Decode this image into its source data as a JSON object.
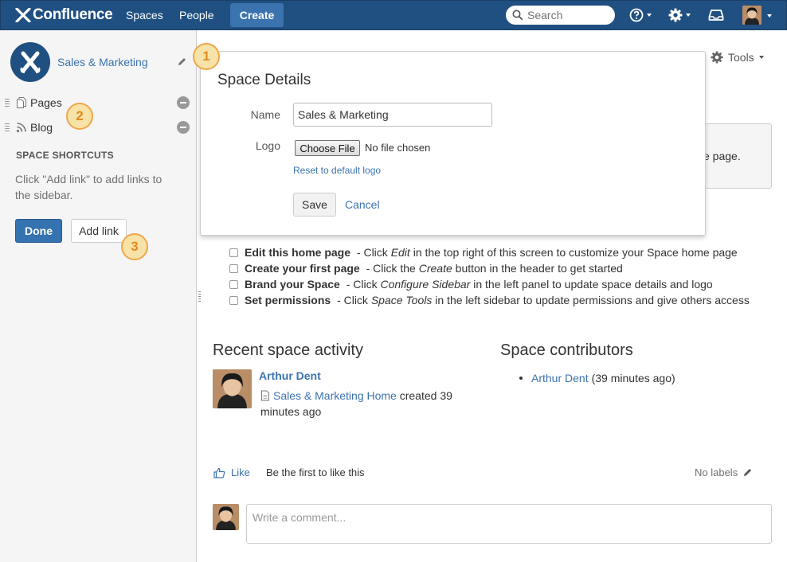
{
  "header": {
    "logo_text": "Confluence",
    "nav": {
      "spaces": "Spaces",
      "people": "People"
    },
    "create_label": "Create",
    "search_placeholder": "Search",
    "icons": [
      "help-icon",
      "gear-icon",
      "notifications-icon",
      "user-avatar"
    ],
    "brand_color": "#205081"
  },
  "sidebar": {
    "space_name": "Sales & Marketing",
    "items": [
      {
        "label": "Pages",
        "icon": "pages-icon"
      },
      {
        "label": "Blog",
        "icon": "blog-rss-icon"
      }
    ],
    "shortcuts_title": "SPACE SHORTCUTS",
    "shortcuts_help": "Click \"Add link\" to add links to the sidebar.",
    "done_label": "Done",
    "add_link_label": "Add link"
  },
  "callouts": [
    "1",
    "2",
    "3"
  ],
  "dialog": {
    "title": "Space Details",
    "name_label": "Name",
    "name_value": "Sales & Marketing",
    "logo_label": "Logo",
    "choose_file": "Choose File",
    "no_file": "No file chosen",
    "reset_logo": "Reset to default logo",
    "save_label": "Save",
    "cancel_label": "Cancel"
  },
  "main": {
    "tools_label": "Tools",
    "info_partial": "e page.",
    "tasks": [
      {
        "bold": "Edit this home page",
        "parts": [
          " - Click ",
          "Edit",
          " in the top right of this screen to customize your Space home page"
        ]
      },
      {
        "bold": "Create your first page",
        "parts": [
          " - Click the ",
          "Create",
          " button in the header to get started"
        ]
      },
      {
        "bold": "Brand your Space",
        "parts": [
          " - Click ",
          "Configure Sidebar",
          " in the left panel to update space details and logo"
        ]
      },
      {
        "bold": "Set permissions",
        "parts": [
          " - Click ",
          "Space Tools",
          " in the left sidebar to update permissions and give others access"
        ]
      }
    ],
    "recent_title": "Recent space activity",
    "activity": {
      "user": "Arthur Dent",
      "page": "Sales & Marketing Home",
      "action": " created 39 minutes ago"
    },
    "contributors_title": "Space contributors",
    "contributor": {
      "name": "Arthur Dent",
      "time": "(39 minutes ago)"
    },
    "like_label": "Like",
    "first_like": "Be the first to like this",
    "no_labels": "No labels",
    "comment_placeholder": "Write a comment..."
  }
}
